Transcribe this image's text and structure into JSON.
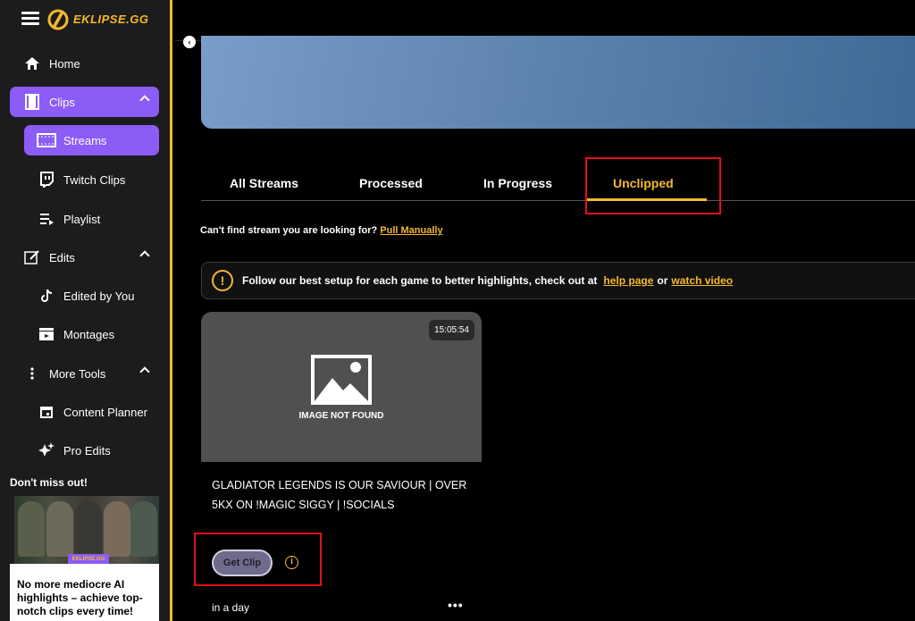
{
  "brand": {
    "logo_text": "EKLIPSE.GG",
    "accent": "#f5b82e",
    "purple": "#8b5cf6"
  },
  "sidebar": {
    "items": [
      {
        "label": "Home",
        "icon": "home-icon"
      },
      {
        "label": "Clips",
        "icon": "film-icon"
      },
      {
        "label": "Streams",
        "icon": "film-strip-icon"
      },
      {
        "label": "Twitch Clips",
        "icon": "twitch-icon"
      },
      {
        "label": "Playlist",
        "icon": "playlist-icon"
      },
      {
        "label": "Edits",
        "icon": "edit-icon"
      },
      {
        "label": "Edited by You",
        "icon": "tiktok-icon"
      },
      {
        "label": "Montages",
        "icon": "clapper-icon"
      },
      {
        "label": "More Tools",
        "icon": "kebab-icon"
      },
      {
        "label": "Content Planner",
        "icon": "calendar-icon"
      },
      {
        "label": "Pro Edits",
        "icon": "sparkle-icon"
      }
    ],
    "promo": {
      "title": "Don't miss out!",
      "text": "No more mediocre AI highlights – achieve top-notch clips every time!"
    }
  },
  "tabs": [
    "All Streams",
    "Processed",
    "In Progress",
    "Unclipped"
  ],
  "active_tab": "Unclipped",
  "pull": {
    "text": "Can't find stream you are looking for?",
    "link": "Pull Manually"
  },
  "notice": {
    "text": "Follow our best setup for each game to better highlights, check out at",
    "link1": "help page",
    "or": "or",
    "link2": "watch video"
  },
  "card": {
    "duration": "15:05:54",
    "image_missing": "IMAGE NOT FOUND",
    "title": "GLADIATOR LEGENDS IS OUR SAVIOUR | OVER 5KX ON !MAGIC SIGGY | !SOCIALS",
    "button": "Get Clip",
    "time_ago": "in a day",
    "more": "•••"
  }
}
